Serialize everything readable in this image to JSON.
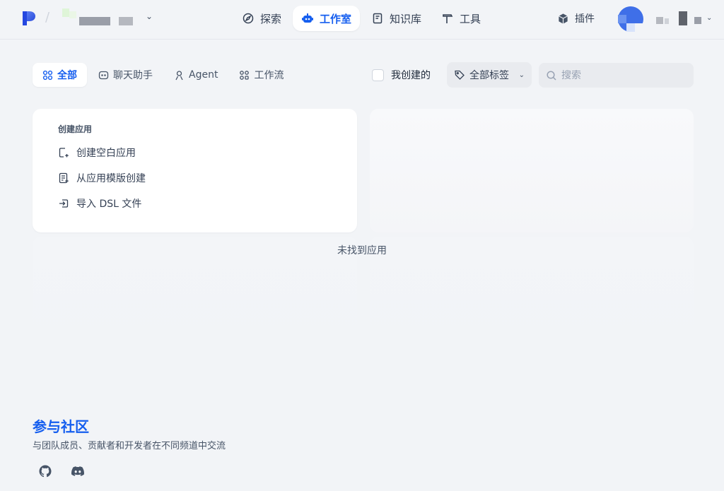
{
  "header": {
    "nav": [
      {
        "label": "探索",
        "icon": "compass-icon",
        "active": false
      },
      {
        "label": "工作室",
        "icon": "robot-icon",
        "active": true
      },
      {
        "label": "知识库",
        "icon": "book-icon",
        "active": false
      },
      {
        "label": "工具",
        "icon": "hammer-icon",
        "active": false
      }
    ],
    "plugins_label": "插件"
  },
  "filters": {
    "tabs": [
      {
        "label": "全部",
        "icon": "grid-icon",
        "active": true
      },
      {
        "label": "聊天助手",
        "icon": "chat-icon",
        "active": false
      },
      {
        "label": "Agent",
        "icon": "agent-icon",
        "active": false
      },
      {
        "label": "工作流",
        "icon": "workflow-icon",
        "active": false
      }
    ],
    "mine_label": "我创建的",
    "tags_label": "全部标签",
    "search_placeholder": "搜索"
  },
  "create_card": {
    "title": "创建应用",
    "items": [
      {
        "label": "创建空白应用",
        "icon": "new-file-icon"
      },
      {
        "label": "从应用模版创建",
        "icon": "template-icon"
      },
      {
        "label": "导入 DSL 文件",
        "icon": "import-icon"
      }
    ]
  },
  "empty_text": "未找到应用",
  "community": {
    "title": "参与社区",
    "description": "与团队成员、贡献者和开发者在不同频道中交流"
  },
  "colors": {
    "accent": "#155eef",
    "background": "#f2f4f7"
  }
}
